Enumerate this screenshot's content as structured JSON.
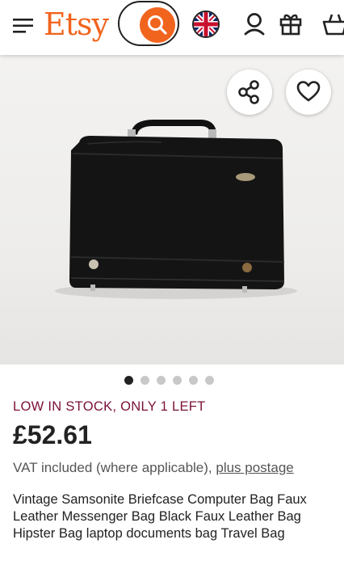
{
  "header": {
    "logo": "Etsy",
    "icons": [
      "menu-icon",
      "search-icon",
      "uk-flag-icon",
      "account-icon",
      "gift-icon",
      "basket-icon"
    ]
  },
  "listing": {
    "gallery": {
      "image_alt": "Black leather briefcase",
      "slide_count": 6,
      "active_slide": 1,
      "share_icon": "share-icon",
      "favorite_icon": "heart-icon"
    },
    "stock_note": "LOW IN STOCK, ONLY 1 LEFT",
    "price": "£52.61",
    "vat_text": "VAT included (where applicable), ",
    "postage_link": "plus postage",
    "title": "Vintage Samsonite Briefcase Computer Bag Faux Leather Messenger Bag Black Faux Leather Bag Hipster Bag laptop documents bag Travel Bag"
  },
  "colors": {
    "brand": "#f1641e",
    "stock_text": "#7a1038",
    "active_dot": "#222222",
    "inactive_dot": "#c8c8c8"
  }
}
